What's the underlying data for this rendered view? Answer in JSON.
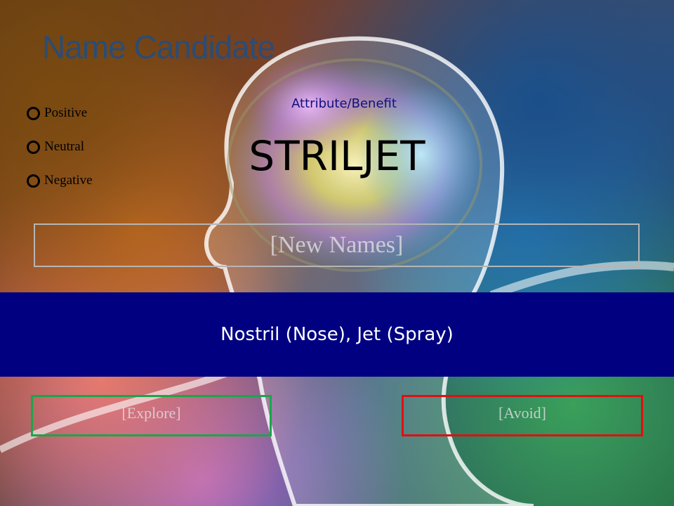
{
  "slide": {
    "title": "Name Candidate",
    "rating_options": [
      {
        "label": "Positive"
      },
      {
        "label": "Neutral"
      },
      {
        "label": "Negative"
      }
    ],
    "attribute_label": "Attribute/Benefit",
    "candidate_name": "STRILJET",
    "new_names_placeholder": "[New Names]",
    "meaning": "Nostril (Nose), Jet (Spray)",
    "explore_label": "[Explore]",
    "avoid_label": "[Avoid]"
  },
  "colors": {
    "band": "#000080",
    "title": "#1f4e86",
    "explore_border": "#1aa64a",
    "avoid_border": "#e01010"
  },
  "background_image": "translucent-head-with-glowing-brain-illustration"
}
